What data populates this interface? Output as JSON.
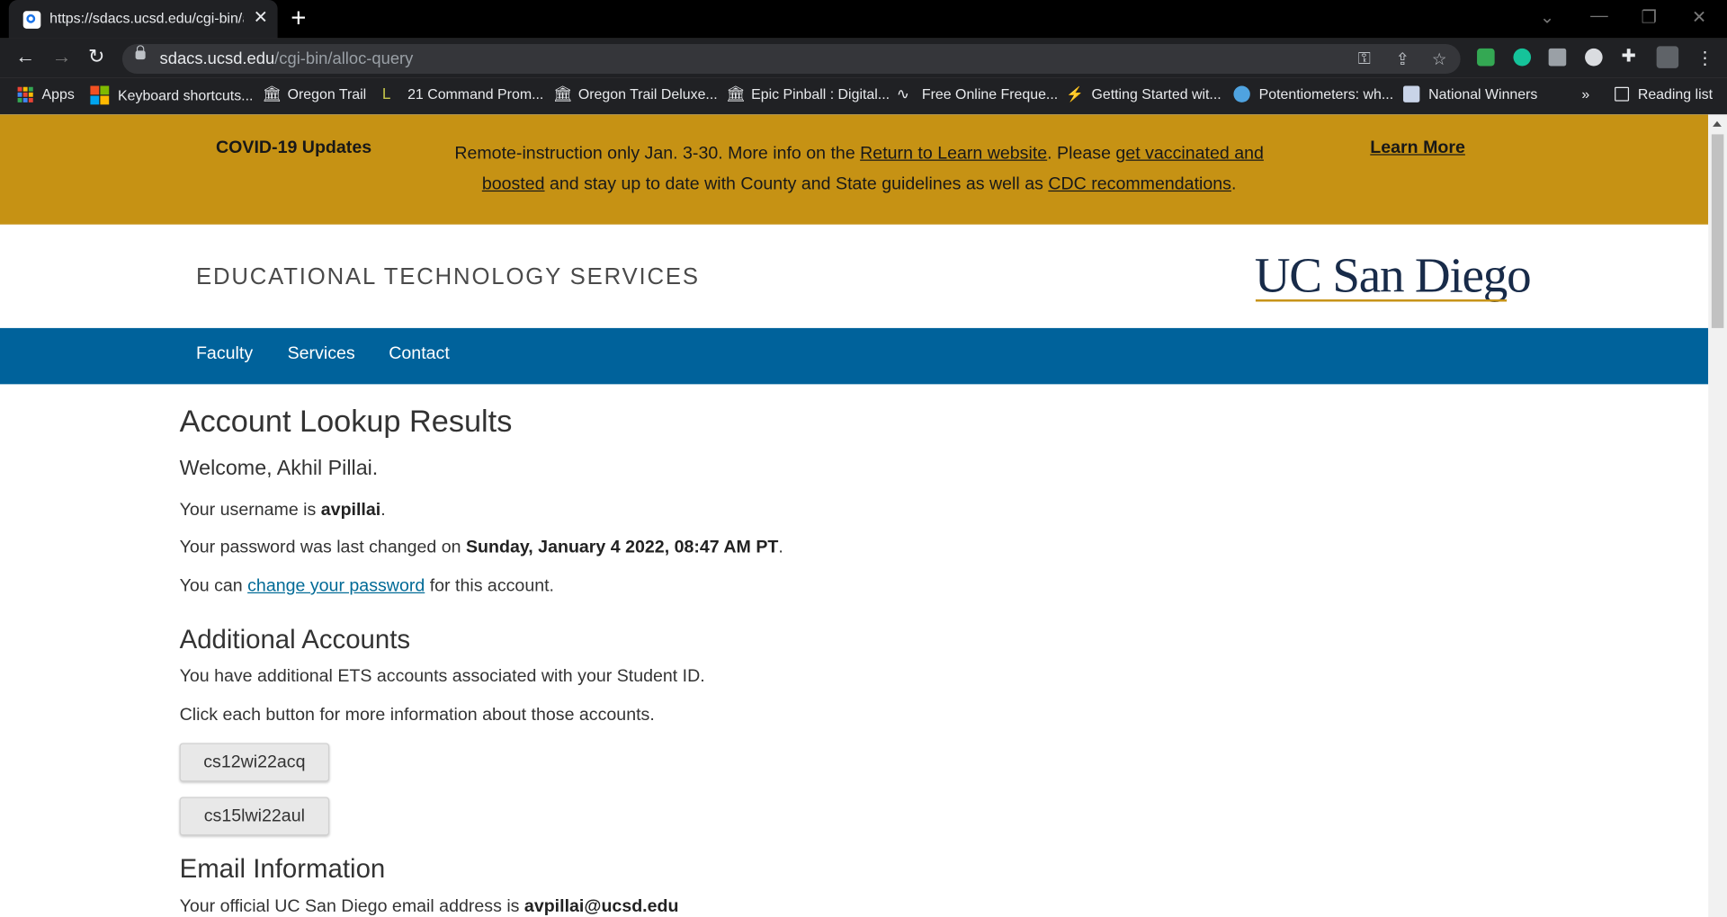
{
  "browser": {
    "tab_title": "https://sdacs.ucsd.edu/cgi-bin/al",
    "url_host": "sdacs.ucsd.edu",
    "url_path": "/cgi-bin/alloc-query",
    "bookmarks": [
      {
        "label": "Apps"
      },
      {
        "label": "Keyboard shortcuts..."
      },
      {
        "label": "Oregon Trail"
      },
      {
        "label": "21 Command Prom..."
      },
      {
        "label": "Oregon Trail Deluxe..."
      },
      {
        "label": "Epic Pinball : Digital..."
      },
      {
        "label": "Free Online Freque..."
      },
      {
        "label": "Getting Started wit..."
      },
      {
        "label": "Potentiometers: wh..."
      },
      {
        "label": "National Winners"
      }
    ],
    "overflow_label": "»",
    "reading_list": "Reading list"
  },
  "banner": {
    "label": "COVID-19 Updates",
    "text1": "Remote-instruction only Jan. 3-30. More info on the ",
    "link1": "Return to Learn website",
    "text2": ". Please ",
    "link2": "get vaccinated and boosted",
    "text3": " and stay up to date with County and State guidelines as well as ",
    "link3": "CDC recommendations",
    "text4": ".",
    "learn_more": "Learn More",
    "color": "#c69214"
  },
  "header": {
    "department": "EDUCATIONAL TECHNOLOGY SERVICES",
    "logo": "UC San Diego"
  },
  "nav": {
    "items": [
      "Faculty",
      "Services",
      "Contact"
    ],
    "color": "#00629b"
  },
  "main": {
    "title": "Account Lookup Results",
    "welcome": "Welcome, Akhil Pillai.",
    "username_prefix": "Your username is ",
    "username": "avpillai",
    "username_suffix": ".",
    "password_prefix": "Your password was last changed on ",
    "password_date": "Sunday, January 4 2022, 08:47 AM PT",
    "password_suffix": ".",
    "change_prefix": "You can ",
    "change_link": "change your password",
    "change_suffix": " for this account.",
    "additional_title": "Additional Accounts",
    "additional_text1": "You have additional ETS accounts associated with your Student ID.",
    "additional_text2": "Click each button for more information about those accounts.",
    "accounts": [
      "cs12wi22acq",
      "cs15lwi22aul"
    ],
    "email_title": "Email Information",
    "email_prefix": "Your official UC San Diego email address is ",
    "email": "avpillai@ucsd.edu"
  }
}
